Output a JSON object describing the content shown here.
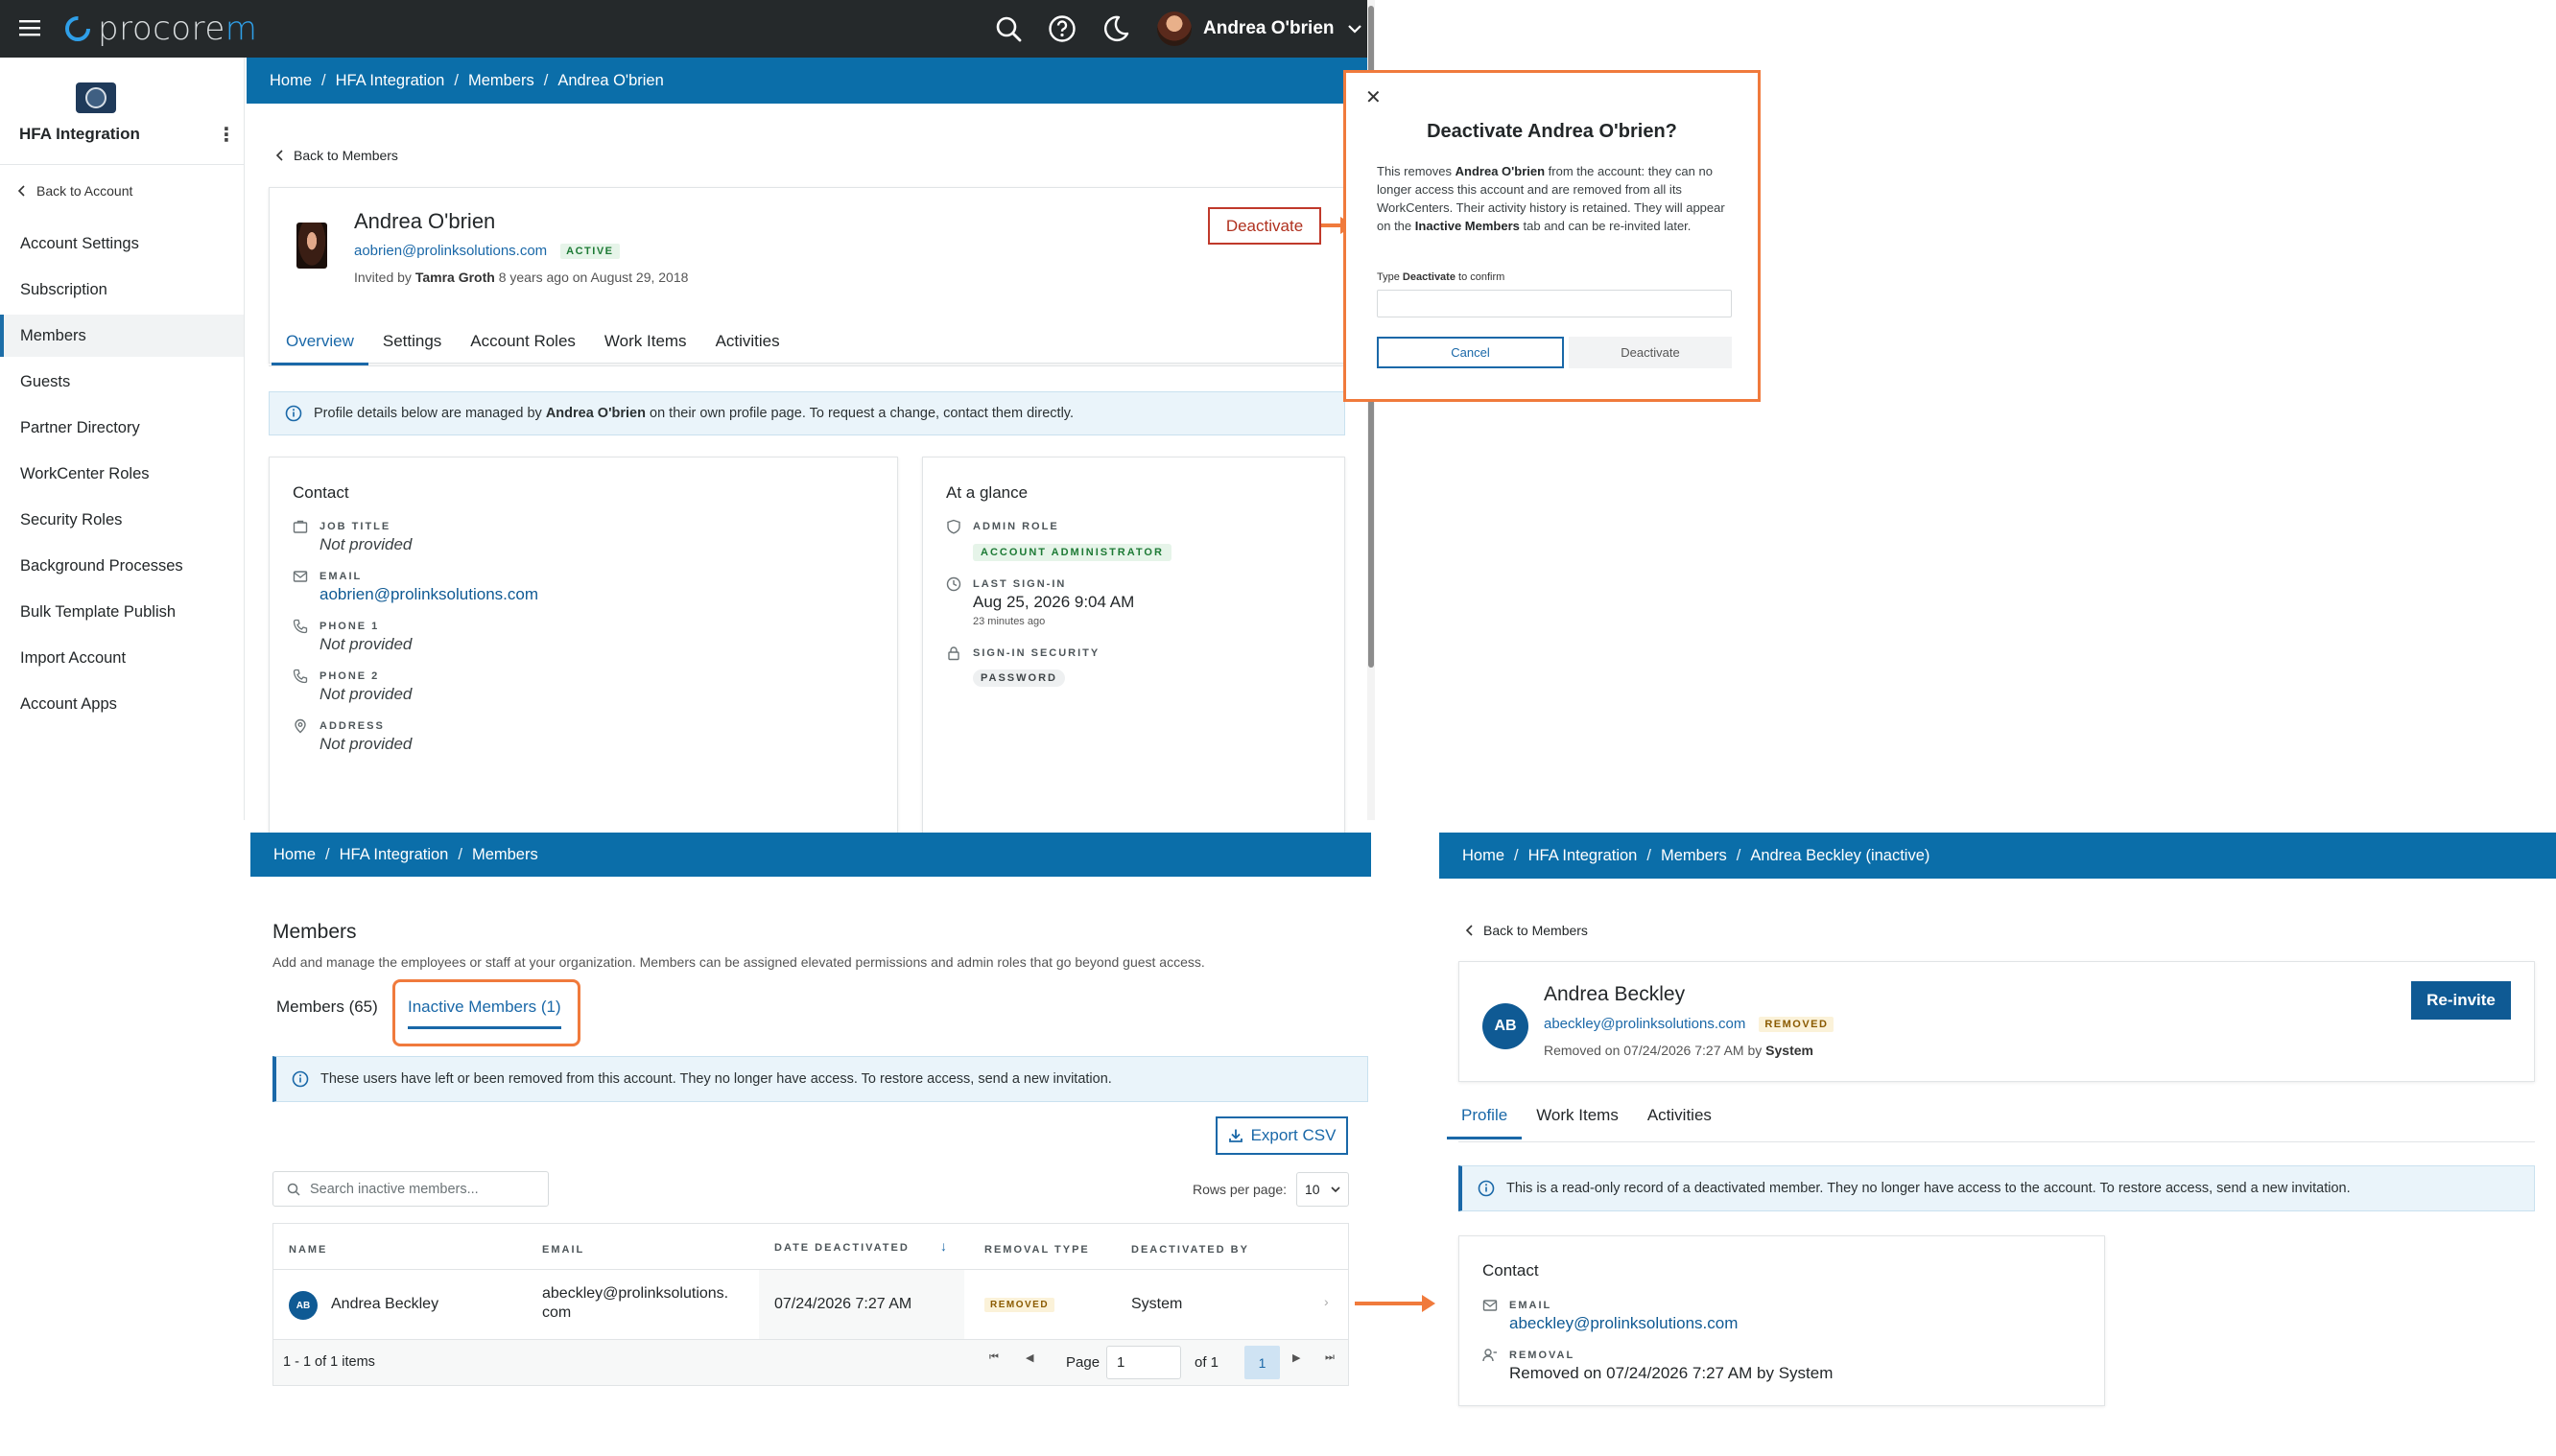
{
  "topbar": {
    "logo_part1": "procore",
    "logo_part2": "m",
    "user_name": "Andrea O'brien"
  },
  "sidebar": {
    "project_name": "HFA Integration",
    "back_label": "Back to Account",
    "items": [
      {
        "label": "Account Settings"
      },
      {
        "label": "Subscription"
      },
      {
        "label": "Members"
      },
      {
        "label": "Guests"
      },
      {
        "label": "Partner Directory"
      },
      {
        "label": "WorkCenter Roles"
      },
      {
        "label": "Security Roles"
      },
      {
        "label": "Background Processes"
      },
      {
        "label": "Bulk Template Publish"
      },
      {
        "label": "Import Account"
      },
      {
        "label": "Account Apps"
      }
    ]
  },
  "profile_top": {
    "breadcrumb": [
      "Home",
      "HFA Integration",
      "Members",
      "Andrea O'brien"
    ],
    "back_label": "Back to Members",
    "name": "Andrea O'brien",
    "email": "aobrien@prolinksolutions.com",
    "status": "ACTIVE",
    "invited_prefix": "Invited by",
    "invited_by": "Tamra Groth",
    "invited_suffix": "8 years ago on August 29, 2018",
    "deactivate_label": "Deactivate",
    "tabs": [
      "Overview",
      "Settings",
      "Account Roles",
      "Work Items",
      "Activities"
    ],
    "banner_pre": "Profile details below are managed by",
    "banner_name": "Andrea O'brien",
    "banner_post": "on their own profile page. To request a change, contact them directly.",
    "contact": {
      "title": "Contact",
      "job_title_label": "JOB TITLE",
      "job_title": "Not provided",
      "email_label": "EMAIL",
      "email": "aobrien@prolinksolutions.com",
      "phone1_label": "PHONE 1",
      "phone1": "Not provided",
      "phone2_label": "PHONE 2",
      "phone2": "Not provided",
      "address_label": "ADDRESS",
      "address": "Not provided"
    },
    "glance": {
      "title": "At a glance",
      "admin_role_label": "ADMIN ROLE",
      "admin_role": "ACCOUNT ADMINISTRATOR",
      "last_signin_label": "LAST SIGN-IN",
      "last_signin": "Aug 25, 2026 9:04 AM",
      "last_signin_ago": "23 minutes ago",
      "signin_security_label": "SIGN-IN SECURITY",
      "signin_security": "PASSWORD"
    }
  },
  "modal": {
    "title": "Deactivate Andrea O'brien?",
    "desc_1": "This removes",
    "desc_name": "Andrea O'brien",
    "desc_2": "from the account: they can no longer access this account and are removed from all its WorkCenters. Their activity history is retained. They will appear on the",
    "desc_tab": "Inactive Members",
    "desc_3": "tab and can be re-invited later.",
    "confirm_pre": "Type",
    "confirm_word": "Deactivate",
    "confirm_post": "to confirm",
    "cancel_label": "Cancel",
    "deactivate_label": "Deactivate"
  },
  "members_list": {
    "breadcrumb": [
      "Home",
      "HFA Integration",
      "Members"
    ],
    "title": "Members",
    "subtitle": "Add and manage the employees or staff at your organization. Members can be assigned elevated permissions and admin roles that go beyond guest access.",
    "tabs": [
      "Members (65)",
      "Inactive Members (1)"
    ],
    "banner": "These users have left or been removed from this account. They no longer have access. To restore access, send a new invitation.",
    "export_label": "Export CSV",
    "search_placeholder": "Search inactive members...",
    "rows_per_page_label": "Rows per page:",
    "rows_per_page": "10",
    "columns": [
      "NAME",
      "EMAIL",
      "DATE DEACTIVATED",
      "REMOVAL TYPE",
      "DEACTIVATED BY"
    ],
    "rows": [
      {
        "initials": "AB",
        "name": "Andrea Beckley",
        "email_1": "abeckley@prolinksolutions.",
        "email_2": "com",
        "date": "07/24/2026 7:27 AM",
        "type": "REMOVED",
        "by": "System"
      }
    ],
    "footer_count": "1 - 1 of 1 items",
    "page_label": "Page",
    "page_value": "1",
    "of_label": "of 1",
    "current_page": "1"
  },
  "profile_inactive": {
    "breadcrumb": [
      "Home",
      "HFA Integration",
      "Members",
      "Andrea Beckley (inactive)"
    ],
    "back_label": "Back to Members",
    "initials": "AB",
    "name": "Andrea Beckley",
    "email": "abeckley@prolinksolutions.com",
    "status": "REMOVED",
    "removed_prefix": "Removed on 07/24/2026 7:27 AM by",
    "removed_by": "System",
    "reinvite_label": "Re-invite",
    "tabs": [
      "Profile",
      "Work Items",
      "Activities"
    ],
    "banner": "This is a read-only record of a deactivated member. They no longer have access to the account. To restore access, send a new invitation.",
    "contact": {
      "title": "Contact",
      "email_label": "EMAIL",
      "email": "abeckley@prolinksolutions.com",
      "removal_label": "REMOVAL",
      "removal": "Removed on 07/24/2026 7:27 AM by System"
    }
  },
  "colors": {
    "brand_blue": "#0b6ea9",
    "link_blue": "#1a68a8",
    "topbar": "#25292b",
    "annotation_orange": "#f07a3c",
    "danger_red": "#c0392b"
  }
}
